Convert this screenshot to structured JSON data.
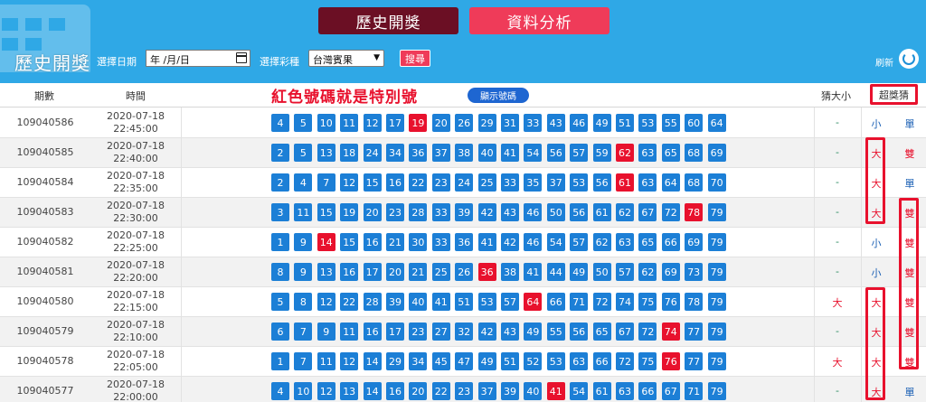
{
  "tabs": {
    "history": "歷史開獎",
    "analysis": "資料分析"
  },
  "brand_title": "歷史開獎",
  "toolbar": {
    "date_label": "選擇日期",
    "date_value": "年 /月/日",
    "lottery_label": "選擇彩種",
    "lottery_value": "台灣賓果",
    "search_label": "搜尋",
    "refresh_label": "刷新"
  },
  "colors": {
    "header": "#2fa8e6",
    "tab_history": "#6b0f24",
    "tab_analysis": "#ef3b59",
    "ball": "#1c7fd6",
    "special": "#e8112d"
  },
  "table_header": {
    "issue": "期數",
    "time": "時間",
    "annotation": "紅色號碼就是特別號",
    "show_numbers_button": "顯示號碼",
    "guess": "猜大小",
    "super": "超獎猜"
  },
  "rows": [
    {
      "issue": "109040586",
      "date": "2020-07-18",
      "time": "22:45:00",
      "numbers": [
        4,
        5,
        10,
        11,
        12,
        17,
        19,
        20,
        26,
        29,
        31,
        33,
        43,
        46,
        49,
        51,
        53,
        55,
        60,
        64
      ],
      "special": 19,
      "guess": "-",
      "size": "小",
      "oe": "單"
    },
    {
      "issue": "109040585",
      "date": "2020-07-18",
      "time": "22:40:00",
      "numbers": [
        2,
        5,
        13,
        18,
        24,
        34,
        36,
        37,
        38,
        40,
        41,
        54,
        56,
        57,
        59,
        62,
        63,
        65,
        68,
        69
      ],
      "special": 62,
      "guess": "-",
      "size": "大",
      "oe": "雙"
    },
    {
      "issue": "109040584",
      "date": "2020-07-18",
      "time": "22:35:00",
      "numbers": [
        2,
        4,
        7,
        12,
        15,
        16,
        22,
        23,
        24,
        25,
        33,
        35,
        37,
        53,
        56,
        61,
        63,
        64,
        68,
        70
      ],
      "special": 61,
      "guess": "-",
      "size": "大",
      "oe": "單"
    },
    {
      "issue": "109040583",
      "date": "2020-07-18",
      "time": "22:30:00",
      "numbers": [
        3,
        11,
        15,
        19,
        20,
        23,
        28,
        33,
        39,
        42,
        43,
        46,
        50,
        56,
        61,
        62,
        67,
        72,
        78,
        79
      ],
      "special": 78,
      "guess": "-",
      "size": "大",
      "oe": "雙"
    },
    {
      "issue": "109040582",
      "date": "2020-07-18",
      "time": "22:25:00",
      "numbers": [
        1,
        9,
        14,
        15,
        16,
        21,
        30,
        33,
        36,
        41,
        42,
        46,
        54,
        57,
        62,
        63,
        65,
        66,
        69,
        79
      ],
      "special": 14,
      "guess": "-",
      "size": "小",
      "oe": "雙"
    },
    {
      "issue": "109040581",
      "date": "2020-07-18",
      "time": "22:20:00",
      "numbers": [
        8,
        9,
        13,
        16,
        17,
        20,
        21,
        25,
        26,
        36,
        38,
        41,
        44,
        49,
        50,
        57,
        62,
        69,
        73,
        79
      ],
      "special": 36,
      "guess": "-",
      "size": "小",
      "oe": "雙"
    },
    {
      "issue": "109040580",
      "date": "2020-07-18",
      "time": "22:15:00",
      "numbers": [
        5,
        8,
        12,
        22,
        28,
        39,
        40,
        41,
        51,
        53,
        57,
        64,
        66,
        71,
        72,
        74,
        75,
        76,
        78,
        79
      ],
      "special": 64,
      "guess": "大",
      "size": "大",
      "oe": "雙"
    },
    {
      "issue": "109040579",
      "date": "2020-07-18",
      "time": "22:10:00",
      "numbers": [
        6,
        7,
        9,
        11,
        16,
        17,
        23,
        27,
        32,
        42,
        43,
        49,
        55,
        56,
        65,
        67,
        72,
        74,
        77,
        79
      ],
      "special": 74,
      "guess": "-",
      "size": "大",
      "oe": "雙"
    },
    {
      "issue": "109040578",
      "date": "2020-07-18",
      "time": "22:05:00",
      "numbers": [
        1,
        7,
        11,
        12,
        14,
        29,
        34,
        45,
        47,
        49,
        51,
        52,
        53,
        63,
        66,
        72,
        75,
        76,
        77,
        79
      ],
      "special": 76,
      "guess": "大",
      "size": "大",
      "oe": "雙"
    },
    {
      "issue": "109040577",
      "date": "2020-07-18",
      "time": "22:00:00",
      "numbers": [
        4,
        10,
        12,
        13,
        14,
        16,
        20,
        22,
        23,
        37,
        39,
        40,
        41,
        54,
        61,
        63,
        66,
        67,
        71,
        79
      ],
      "special": 41,
      "guess": "-",
      "size": "大",
      "oe": "單"
    }
  ]
}
